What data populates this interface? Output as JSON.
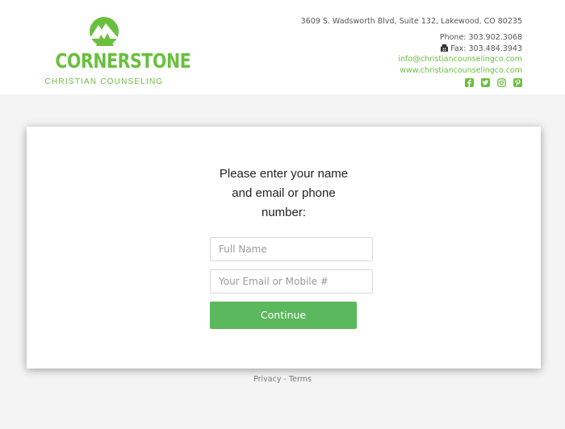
{
  "logo": {
    "name": "CORNERSTONE",
    "subtitle": "CHRISTIAN COUNSELING"
  },
  "contact": {
    "address": "3609 S. Wadsworth Blvd, Suite 132, Lakewood, CO 80235",
    "phone": "Phone: 303.902.3068",
    "fax": "Fax: 303.484.3943",
    "email": "info@christiancounselingco.com",
    "website": "www.christiancounselingco.com"
  },
  "socials": [
    "facebook-icon",
    "twitter-icon",
    "instagram-icon",
    "pinterest-icon"
  ],
  "form": {
    "prompt_line1": "Please enter your name",
    "prompt_line2": "and email or phone",
    "prompt_line3": "number:",
    "name_placeholder": "Full Name",
    "contact_placeholder": "Your Email or Mobile #",
    "continue_label": "Continue"
  },
  "footer": {
    "privacy": "Privacy",
    "separator": " - ",
    "terms": "Terms"
  },
  "colors": {
    "brand_green": "#6abf3f",
    "button_green": "#5cb85c"
  }
}
